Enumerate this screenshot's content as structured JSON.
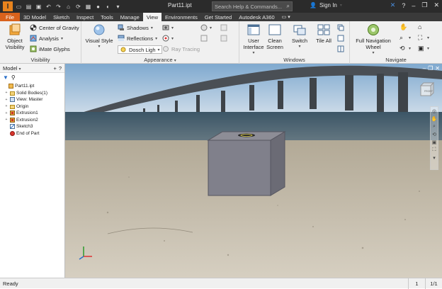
{
  "app": {
    "logo": "I",
    "doc_title": "Part11.ipt"
  },
  "search": {
    "placeholder": "Search Help & Commands..."
  },
  "account": {
    "signin": "Sign In"
  },
  "tabs": [
    {
      "label": "File"
    },
    {
      "label": "3D Model"
    },
    {
      "label": "Sketch"
    },
    {
      "label": "Inspect"
    },
    {
      "label": "Tools"
    },
    {
      "label": "Manage"
    },
    {
      "label": "View"
    },
    {
      "label": "Environments"
    },
    {
      "label": "Get Started"
    },
    {
      "label": "Autodesk A360"
    }
  ],
  "ribbon": {
    "visibility": {
      "title": "Visibility",
      "object_visibility": "Object Visibility",
      "center_of_gravity": "Center of Gravity",
      "analysis": "Analysis",
      "imate_glyphs": "iMate Glyphs"
    },
    "appearance": {
      "title": "Appearance",
      "visual_style": "Visual Style",
      "shadows": "Shadows",
      "reflections": "Reflections",
      "lighting": "Dosch Ligh",
      "ray_tracing": "Ray Tracing"
    },
    "windows": {
      "title": "Windows",
      "user_interface": "User Interface",
      "clean_screen": "Clean Screen",
      "switch": "Switch",
      "tile_all": "Tile All"
    },
    "navigate": {
      "title": "Navigate",
      "full_nav_wheel": "Full Navigation Wheel"
    }
  },
  "browser": {
    "title": "Model",
    "help": "?",
    "items": [
      {
        "label": "Part11.ipt",
        "icon": "part-icon",
        "expander": ""
      },
      {
        "label": "Solid Bodies(1)",
        "icon": "folder-icon",
        "expander": "+"
      },
      {
        "label": "View: Master",
        "icon": "view-icon",
        "expander": "+"
      },
      {
        "label": "Origin",
        "icon": "folder-icon",
        "expander": "+"
      },
      {
        "label": "Extrusion1",
        "icon": "extrusion-icon",
        "expander": "+"
      },
      {
        "label": "Extrusion2",
        "icon": "extrusion-icon",
        "expander": "+"
      },
      {
        "label": "Sketch3",
        "icon": "sketch-icon",
        "expander": ""
      },
      {
        "label": "End of Part",
        "icon": "end-of-part-icon",
        "expander": ""
      }
    ]
  },
  "viewcube": {
    "label": "FRONT"
  },
  "status": {
    "text": "Ready",
    "count": "1",
    "page": "1/1"
  },
  "colors": {
    "file_tab": "#d9621c",
    "titlebar": "#2b2b2b",
    "accent_blue": "#2a6fc9"
  }
}
